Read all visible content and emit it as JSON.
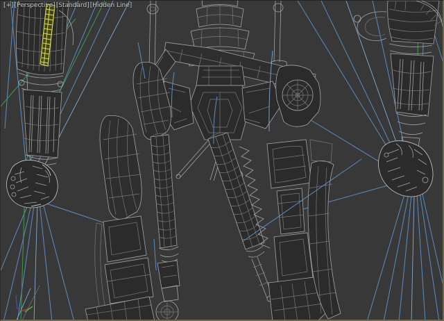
{
  "viewport_label": {
    "general_menu": "[+]",
    "point_of_view_menu": "[Perspective]",
    "render_preset_menu": "[Standard]",
    "shading_menu": "[Hidden Line]"
  },
  "colors": {
    "bg": "#383838",
    "wire": "#a6a6a6",
    "wire-bright": "#c9c9c9",
    "wire-dim": "#7a7a7a",
    "panel": "#2b2b2b",
    "panel2": "#2e2e2e",
    "spline-blue": "#5b8cc3",
    "spline-blue-light": "#83abd6",
    "spline-green": "#3f9c4b",
    "selection-yellow": "#e3e34c",
    "axis-red": "#b5453c",
    "axis-green": "#4fae4f",
    "axis-blue": "#3c50b4",
    "border": "#6e6750",
    "label-text": "#c8c8c8"
  }
}
